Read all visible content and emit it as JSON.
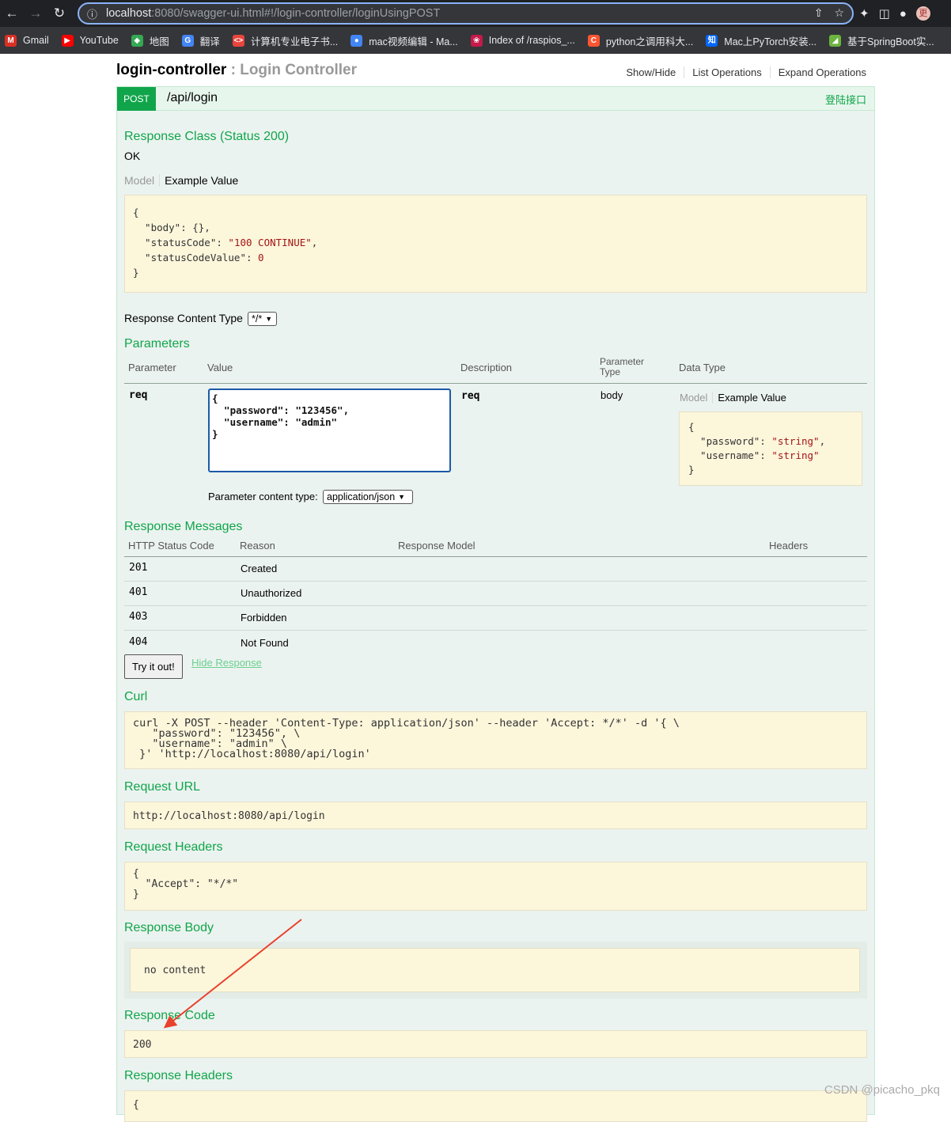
{
  "browser": {
    "url_host": "localhost",
    "url_rest": ":8080/swagger-ui.html#!/login-controller/loginUsingPOST",
    "bookmarks": [
      {
        "label": "Gmail",
        "color": "#d93025",
        "glyph": "M"
      },
      {
        "label": "YouTube",
        "color": "#ff0000",
        "glyph": "▶"
      },
      {
        "label": "地图",
        "color": "#34a853",
        "glyph": "◆"
      },
      {
        "label": "翻译",
        "color": "#4285f4",
        "glyph": "G"
      },
      {
        "label": "计算机专业电子书...",
        "color": "#e8453c",
        "glyph": "<>"
      },
      {
        "label": "mac视频编辑 - Ma...",
        "color": "#4285f4",
        "glyph": "●"
      },
      {
        "label": "Index of /raspios_...",
        "color": "#c51a4a",
        "glyph": "❀"
      },
      {
        "label": "python之调用科大...",
        "color": "#fc5531",
        "glyph": "C"
      },
      {
        "label": "Mac上PyTorch安装...",
        "color": "#0066ff",
        "glyph": "知"
      },
      {
        "label": "基于SpringBoot实...",
        "color": "#6db33f",
        "glyph": "◢"
      }
    ]
  },
  "resource": {
    "name": "login-controller",
    "separator": " : ",
    "description": "Login Controller",
    "ops": [
      "Show/Hide",
      "List Operations",
      "Expand Operations"
    ]
  },
  "operation": {
    "method": "POST",
    "path": "/api/login",
    "summary": "登陆接口"
  },
  "response_class": {
    "title": "Response Class (Status 200)",
    "status_text": "OK",
    "tab_model": "Model",
    "tab_example": "Example Value",
    "example": {
      "open": "{",
      "line1_key": "  \"body\": {},",
      "line2_key": "  \"statusCode\": ",
      "line2_val": "\"100 CONTINUE\"",
      "line2_tail": ",",
      "line3_key": "  \"statusCodeValue\": ",
      "line3_val": "0",
      "close": "}"
    }
  },
  "response_content_type": {
    "label": "Response Content Type",
    "value": "*/*"
  },
  "parameters": {
    "title": "Parameters",
    "headers": [
      "Parameter",
      "Value",
      "Description",
      "Parameter Type",
      "Data Type"
    ],
    "param_type_line1": "Parameter",
    "param_type_line2": "Type",
    "row": {
      "name": "req",
      "value_text": "{\n  \"password\": \"123456\",\n  \"username\": \"admin\"\n}",
      "description": "req",
      "param_type": "body",
      "model_tab": "Model",
      "example_tab": "Example Value",
      "example_open": "{",
      "example_l1_key": "  \"password\": ",
      "example_l1_val": "\"string\"",
      "example_l2_key": "  \"username\": ",
      "example_l2_val": "\"string\"",
      "example_close": "}"
    },
    "content_type_label": "Parameter content type:",
    "content_type_value": "application/json"
  },
  "response_messages": {
    "title": "Response Messages",
    "headers": [
      "HTTP Status Code",
      "Reason",
      "Response Model",
      "Headers"
    ],
    "rows": [
      {
        "code": "201",
        "reason": "Created"
      },
      {
        "code": "401",
        "reason": "Unauthorized"
      },
      {
        "code": "403",
        "reason": "Forbidden"
      },
      {
        "code": "404",
        "reason": "Not Found"
      }
    ]
  },
  "actions": {
    "try_label": "Try it out!",
    "hide_label": "Hide Response"
  },
  "curl": {
    "title": "Curl",
    "text": "curl -X POST --header 'Content-Type: application/json' --header 'Accept: */*' -d '{ \\\n   \"password\": \"123456\", \\\n   \"username\": \"admin\" \\\n }' 'http://localhost:8080/api/login'"
  },
  "request_url": {
    "title": "Request URL",
    "value": "http://localhost:8080/api/login"
  },
  "request_headers": {
    "title": "Request Headers",
    "text": "{\n  \"Accept\": \"*/*\"\n}"
  },
  "response_body": {
    "title": "Response Body",
    "value": "no content"
  },
  "response_code": {
    "title": "Response Code",
    "value": "200"
  },
  "response_headers": {
    "title": "Response Headers",
    "text": "{"
  },
  "watermark": "CSDN @picacho_pkq",
  "colors": {
    "accent_green": "#10a54a",
    "code_bg": "#fcf6db",
    "op_bg": "#ebf3f0",
    "arrow": "#e8412c"
  }
}
